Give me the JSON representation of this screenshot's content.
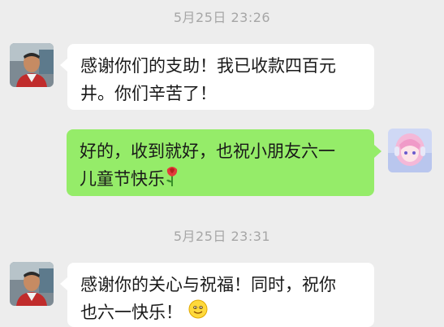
{
  "messages": [
    {
      "timestamp": "5月25日 23:26"
    },
    {
      "text": "感谢你们的支助！我已收款四百元井。你们辛苦了！",
      "line1": "感谢你们的支助！我已收款四百元",
      "line2": "井。你们辛苦了！",
      "sender": "received",
      "avatar_icon": "man-avatar-icon"
    },
    {
      "text": "好的，收到就好，也祝小朋友六一儿童节快乐",
      "line1": "好的，收到就好，也祝小朋友六一",
      "line2": "儿童节快乐",
      "sender": "sent",
      "avatar_icon": "anime-girl-avatar-icon",
      "emoji": "rose-emoji-icon"
    },
    {
      "timestamp": "5月25日 23:31"
    },
    {
      "text": "感谢你的关心与祝福！同时，祝你也六一快乐！",
      "line1": "感谢你的关心与祝福！同时，祝你",
      "line2": "也六一快乐！",
      "sender": "received",
      "avatar_icon": "man-avatar-icon",
      "emoji": "smile-emoji-icon"
    }
  ],
  "colors": {
    "background": "#ededed",
    "received_bubble": "#ffffff",
    "sent_bubble": "#95ec69",
    "timestamp_text": "#a6a6a6"
  }
}
